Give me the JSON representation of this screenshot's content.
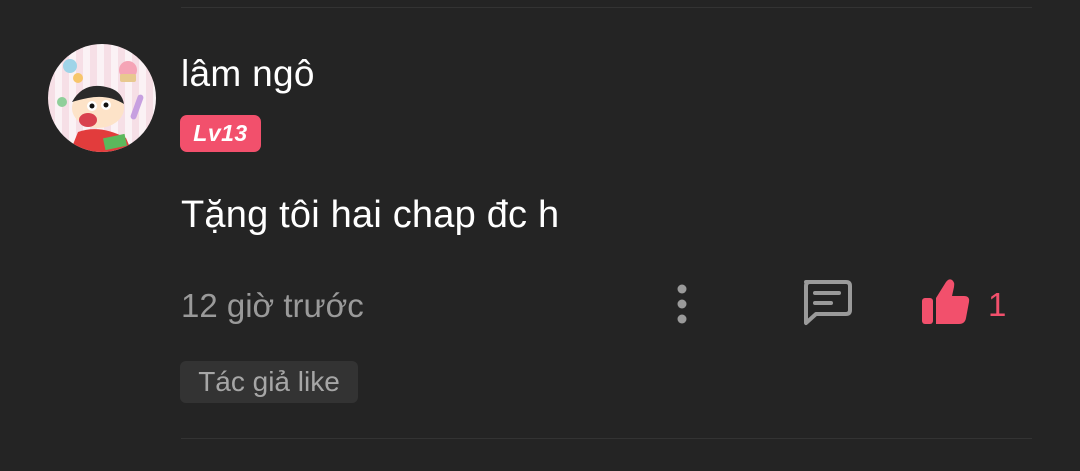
{
  "comment": {
    "author": "lâm ngô",
    "level": "Lv13",
    "text": "Tặng tôi hai chap đc h",
    "time": "12 giờ trước",
    "likes": "1",
    "tag": "Tác giả like"
  },
  "colors": {
    "background": "#242424",
    "accent": "#f2506c",
    "muted_text": "#9a9a9a",
    "chip_background": "#333333"
  },
  "icons": {
    "avatar": "cartoon-boy-avatar",
    "more": "more-vertical-icon",
    "reply": "comment-icon",
    "like": "thumbs-up-icon"
  }
}
